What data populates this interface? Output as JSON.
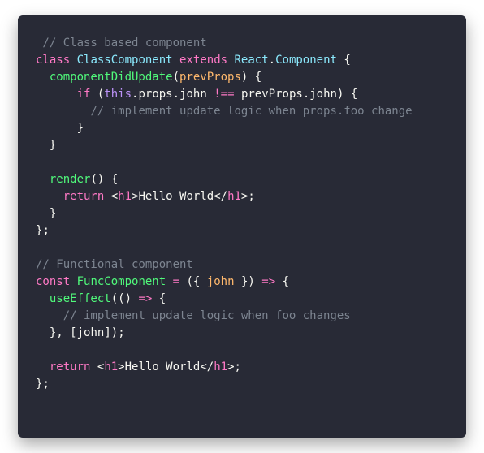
{
  "code": {
    "line1_comment": " // Class based component",
    "kw_class": "class",
    "name_classcomp": "ClassComponent",
    "kw_extends": "extends",
    "name_react": "React",
    "name_component": "Component",
    "fn_cdu": "componentDidUpdate",
    "param_prevprops": "prevProps",
    "kw_if": "if",
    "kw_this": "this",
    "prop_props": "props",
    "prop_john": "john",
    "op_neq": "!==",
    "comment_update1": "// implement update logic when props.foo change",
    "fn_render": "render",
    "kw_return": "return",
    "tag_open_h1": "h1",
    "txt_hello": "Hello World",
    "tag_close_h1": "h1",
    "comment_func": "// Functional component",
    "kw_const": "const",
    "name_funccomp": "FuncComponent",
    "op_eq": "=",
    "op_arrow": "=>",
    "fn_useeffect": "useEffect",
    "comment_update2": "// implement update logic when foo changes",
    "punct_obrace": "{",
    "punct_cbrace": "}",
    "punct_oparen": "(",
    "punct_cparen": ")",
    "punct_obracket": "[",
    "punct_cbracket": "]",
    "punct_semi": ";",
    "punct_dot": ".",
    "punct_comma": ",",
    "punct_lt": "<",
    "punct_gt": ">",
    "punct_slash": "/"
  }
}
